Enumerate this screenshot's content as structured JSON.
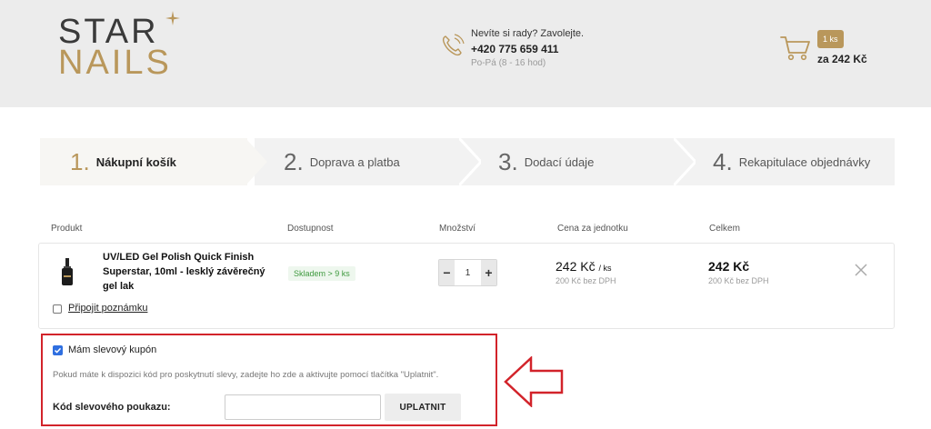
{
  "header": {
    "logo": {
      "line1": "STAR",
      "line2": "NAILS"
    },
    "contact": {
      "question": "Nevíte si rady? Zavolejte.",
      "phone": "+420 775 659 411",
      "hours": "Po-Pá (8 - 16 hod)"
    },
    "cart": {
      "badge": "1 ks",
      "total": "za 242 Kč"
    }
  },
  "steps": [
    {
      "num": "1.",
      "label": "Nákupní košík",
      "active": true
    },
    {
      "num": "2.",
      "label": "Doprava a platba",
      "active": false
    },
    {
      "num": "3.",
      "label": "Dodací údaje",
      "active": false
    },
    {
      "num": "4.",
      "label": "Rekapitulace objednávky",
      "active": false
    }
  ],
  "table": {
    "headers": [
      "Produkt",
      "Dostupnost",
      "Množství",
      "Cena za jednotku",
      "Celkem"
    ],
    "item": {
      "name": "UV/LED Gel Polish Quick Finish Superstar, 10ml - lesklý závěrečný gel lak",
      "stock": "Skladem > 9 ks",
      "qty_minus": "−",
      "qty": "1",
      "qty_plus": "+",
      "unit_price": "242 Kč",
      "unit_suffix": "/ ks",
      "unit_price_net": "200 Kč bez DPH",
      "total": "242 Kč",
      "total_net": "200 Kč bez DPH",
      "note_link": "Připojit poznámku"
    }
  },
  "coupon": {
    "checkbox_label": "Mám slevový kupón",
    "checked": true,
    "info": "Pokud máte k dispozici kód pro poskytnutí slevy, zadejte ho zde a aktivujte pomocí tlačítka \"Uplatnit\".",
    "code_label": "Kód slevového poukazu:",
    "code_value": "",
    "apply_label": "UPLATNIT"
  },
  "colors": {
    "accent": "#b9975b",
    "highlight": "#d2232a",
    "checkbox": "#2f6fe0",
    "stock": "#3f9a3f"
  }
}
